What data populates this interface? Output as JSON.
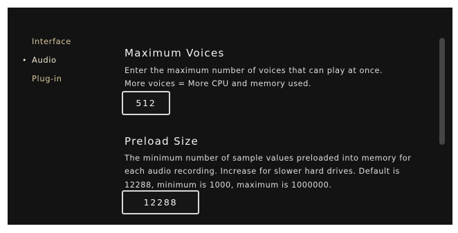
{
  "sidebar": {
    "items": [
      {
        "label": "Interface"
      },
      {
        "label": "Audio",
        "active": true
      },
      {
        "label": "Plug-in"
      }
    ],
    "active_marker": "•"
  },
  "sections": {
    "max_voices": {
      "title": "Maximum Voices",
      "desc_line1": "Enter the maximum number of voices that can play at once.",
      "desc_line2": "More voices = More CPU and memory used.",
      "value": "512"
    },
    "preload_size": {
      "title": "Preload Size",
      "desc_line1": "The minimum number of sample values preloaded into memory for",
      "desc_line2": "each audio recording. Increase for slower hard drives. Default is",
      "desc_line3": "12288, minimum is 1000, maximum is 1000000.",
      "value": "12288"
    }
  },
  "colors": {
    "panel_background": "#131313",
    "sidebar_text": "#d6c39c",
    "body_text": "#dedede",
    "input_border": "#d9d9d9"
  }
}
